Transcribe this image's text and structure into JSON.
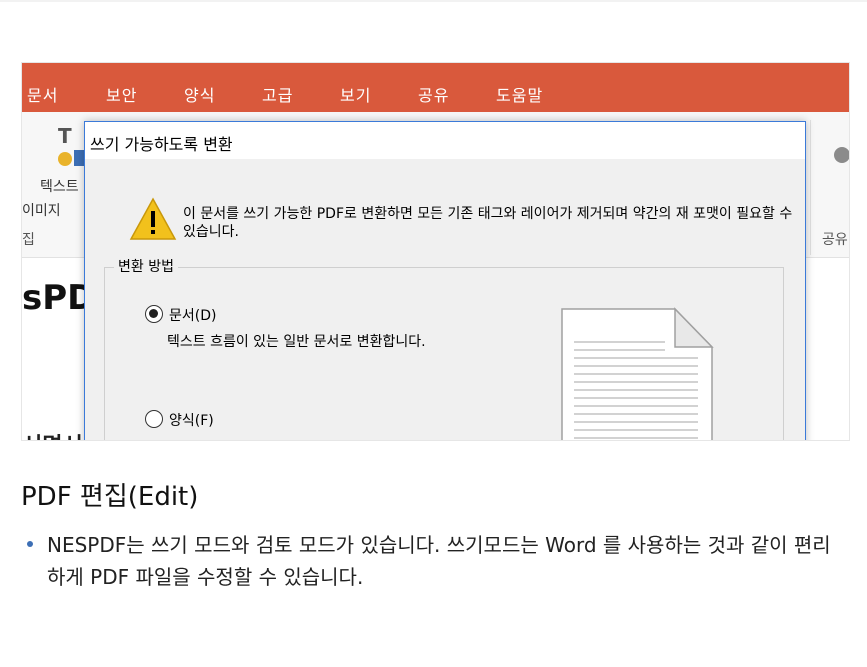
{
  "menubar": {
    "items": [
      "문서",
      "보안",
      "양식",
      "고급",
      "보기",
      "공유",
      "도움말"
    ]
  },
  "ribbon": {
    "label_text": "텍스트",
    "label_image": "이미지",
    "group_left": "집",
    "group_right": "공유"
  },
  "document": {
    "title_fragment": "sPD",
    "bottom_fragment": "서면서"
  },
  "dialog": {
    "title": "쓰기 가능하도록 변환",
    "warning": "이 문서를 쓰기 가능한 PDF로 변환하면 모든 기존 태그와 레이어가 제거되며 약간의 재 포맷이 필요할 수 있습니다.",
    "group_label": "변환 방법",
    "option_document": "문서(D)",
    "option_document_desc": "텍스트 흐름이 있는 일반 문서로 변환합니다.",
    "option_form": "양식(F)"
  },
  "caption": "PDF 편집(Edit)",
  "bullet": "NESPDF는 쓰기 모드와 검토 모드가 있습니다. 쓰기모드는 Word 를 사용하는 것과 같이 편리하게 PDF 파일을 수정할 수 있습니다.",
  "colors": {
    "menubar": "#d9593c",
    "dialog_border": "#3b7ad9",
    "bullet": "#3d6fb5",
    "warning": "#f2c11c"
  }
}
